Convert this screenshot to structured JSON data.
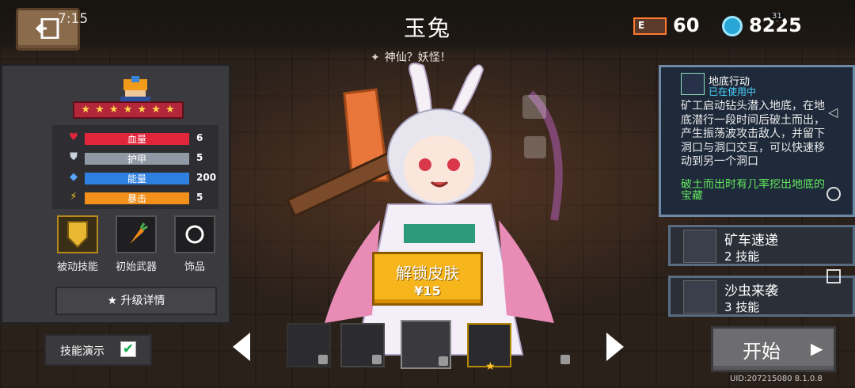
{
  "status": {
    "clock": "7:15"
  },
  "header": {
    "title": "玉兔",
    "tagline": "神仙？妖怪！",
    "energy": {
      "icon_text": "E",
      "value": "60"
    },
    "gems": {
      "value": "8225",
      "badge": "31"
    }
  },
  "character": {
    "stats": [
      {
        "label": "血量",
        "value": "6",
        "color": "#e1253b",
        "icon": "heart-icon"
      },
      {
        "label": "护甲",
        "value": "5",
        "color": "#8f9aa6",
        "icon": "shield-icon"
      },
      {
        "label": "能量",
        "value": "200",
        "color": "#2f7fe0",
        "icon": "diamond-icon"
      },
      {
        "label": "暴击",
        "value": "5",
        "color": "#f2901b",
        "icon": "crit-icon"
      }
    ],
    "items": [
      {
        "label": "被动技能"
      },
      {
        "label": "初始武器"
      },
      {
        "label": "饰品"
      }
    ],
    "upgrade_label": "升级详情",
    "demo_label": "技能演示"
  },
  "unlock": {
    "label": "解锁皮肤",
    "price": "¥15"
  },
  "skill": {
    "name": "地底行动",
    "status": "已在使用中",
    "description": "矿工启动钻头潜入地底，在地底潜行一段时间后破土而出，产生振荡波攻击敌人，并留下洞口与洞口交互，可以快速移动到另一个洞口",
    "extra": "破土而出时有几率挖出地底的宝藏",
    "cards": [
      {
        "name": "矿车速递",
        "sub": "2 技能"
      },
      {
        "name": "沙虫来袭",
        "sub": "3 技能"
      }
    ]
  },
  "start": {
    "label": "开始"
  },
  "uid": "UID:207215080 8.1.0.8",
  "colors": {
    "accent": "#f7b51c",
    "skill_highlight": "#63e85e",
    "status_blue": "#4ad3ff"
  }
}
